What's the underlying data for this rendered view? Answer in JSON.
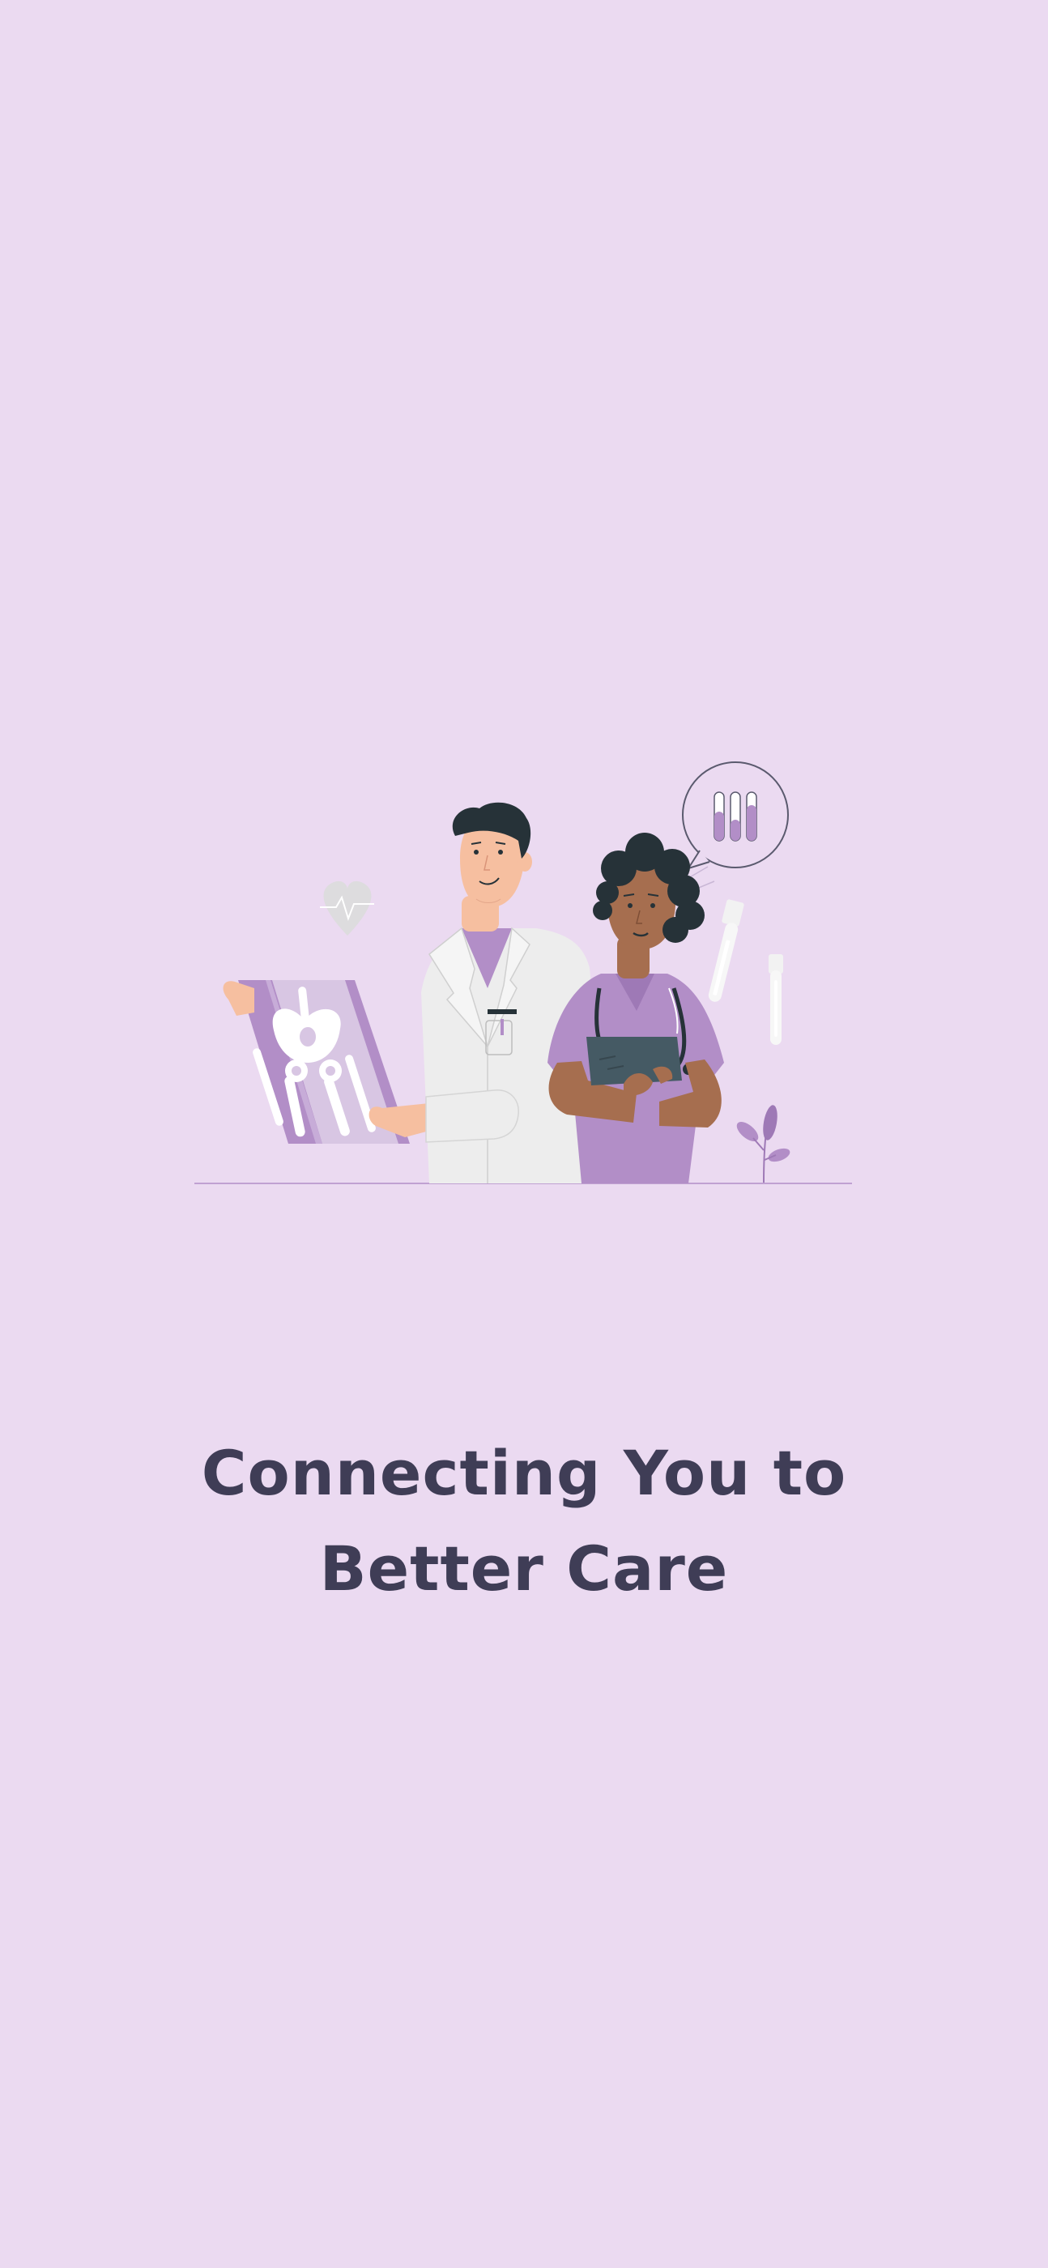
{
  "screen": {
    "background_color": "#EBDAF1"
  },
  "illustration": {
    "subject": "doctors-with-xray-illustration",
    "accent_color": "#B28EC7",
    "dark_color": "#263238"
  },
  "headline": {
    "line1": "Connecting You to",
    "line2": "Better Care",
    "color": "#3F3D56"
  }
}
